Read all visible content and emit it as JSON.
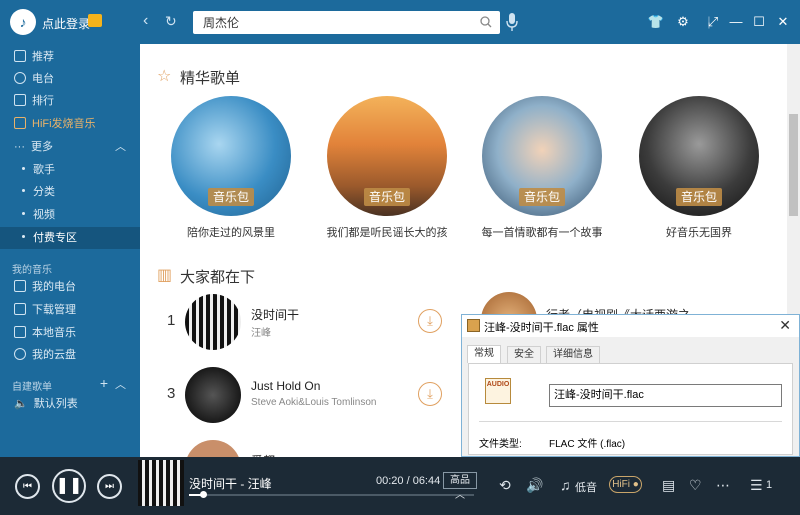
{
  "header": {
    "login": "点此登录",
    "search_value": "周杰伦"
  },
  "sidebar": {
    "items": [
      {
        "label": "推荐"
      },
      {
        "label": "电台"
      },
      {
        "label": "排行"
      },
      {
        "label": "HiFi发烧音乐"
      },
      {
        "label": "更多"
      },
      {
        "label": "歌手"
      },
      {
        "label": "分类"
      },
      {
        "label": "视频"
      },
      {
        "label": "付费专区"
      }
    ],
    "my_music_heading": "我的音乐",
    "my_music": [
      {
        "label": "我的电台"
      },
      {
        "label": "下载管理"
      },
      {
        "label": "本地音乐"
      },
      {
        "label": "我的云盘"
      }
    ],
    "custom_heading": "自建歌单",
    "default_list": "默认列表"
  },
  "main": {
    "featured_title": "精华歌单",
    "playlists": [
      {
        "tag": "音乐包",
        "caption": "陪你走过的风景里"
      },
      {
        "tag": "音乐包",
        "caption": "我们都是听民谣长大的孩"
      },
      {
        "tag": "音乐包",
        "caption": "每一首情歌都有一个故事"
      },
      {
        "tag": "音乐包",
        "caption": "好音乐无国界"
      }
    ],
    "listening_title": "大家都在下",
    "songs": [
      {
        "rank": "1",
        "name": "没时间干",
        "artist": "汪峰"
      },
      {
        "rank": "3",
        "name": "Just Hold On",
        "artist": "Steve Aoki&Louis Tomlinson"
      }
    ],
    "partial_song_text": "行者（电视剧《大话西游之",
    "partial_row_text": "爱都"
  },
  "dialog": {
    "title": "汪峰-没时间干.flac 属性",
    "tabs": [
      "常规",
      "安全",
      "详细信息"
    ],
    "file_icon_label": "AUDIO",
    "filename": "汪峰-没时间干.flac",
    "file_type_label": "文件类型:",
    "file_type_value": "FLAC 文件 (.flac)"
  },
  "player": {
    "now_playing": "没时间干 - 汪峰",
    "time": "00:20 / 06:44",
    "progress_fraction": 0.05,
    "quality": "高品",
    "low_tone": "低音",
    "hifi": "HiFi",
    "queue_count": "1"
  },
  "colors": {
    "brand_blue": "#1c6a9c",
    "player_bg": "#1c2a36",
    "accent_orange": "#e0a060"
  }
}
